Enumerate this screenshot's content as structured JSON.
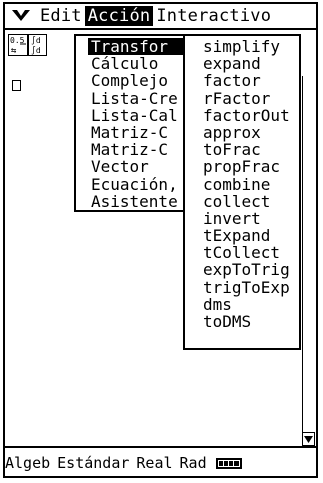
{
  "menubar": {
    "edit": "Edit",
    "accion": "Acción",
    "interactivo": "Interactivo"
  },
  "toolbar": {
    "fraction_icon": "fraction-toggle-icon"
  },
  "menu1": {
    "items": [
      "Transfor",
      "Cálculo",
      "Complejo",
      "Lista-Cre",
      "Lista-Cal",
      "Matriz-C",
      "Matriz-C",
      "Vector",
      "Ecuación,",
      "Asistente"
    ]
  },
  "menu2": {
    "items": [
      "simplify",
      "expand",
      "factor",
      "rFactor",
      "factorOut",
      "approx",
      "toFrac",
      "propFrac",
      "combine",
      "collect",
      "invert",
      "tExpand",
      "tCollect",
      "expToTrig",
      "trigToExp",
      "dms",
      "toDMS"
    ]
  },
  "status": {
    "mode1": "Algeb",
    "mode2": "Estándar",
    "mode3": "Real",
    "mode4": "Rad"
  },
  "colors": {
    "fg": "#000000",
    "bg": "#ffffff"
  }
}
